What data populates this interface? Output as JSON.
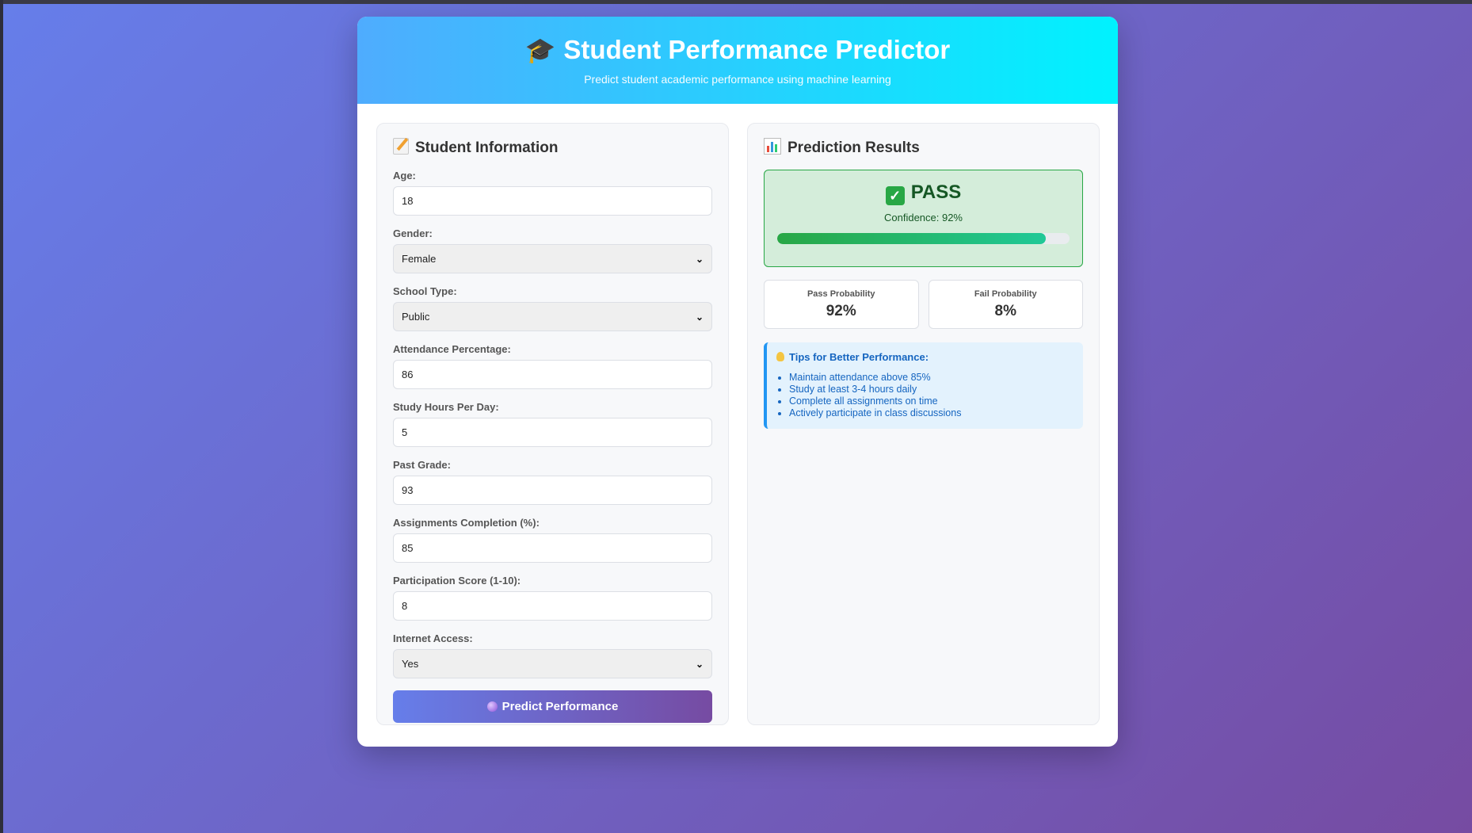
{
  "header": {
    "title": "Student Performance Predictor",
    "subtitle": "Predict student academic performance using machine learning"
  },
  "form": {
    "heading": "Student Information",
    "fields": {
      "age": {
        "label": "Age:",
        "value": "18"
      },
      "gender": {
        "label": "Gender:",
        "value": "Female"
      },
      "school_type": {
        "label": "School Type:",
        "value": "Public"
      },
      "attendance": {
        "label": "Attendance Percentage:",
        "value": "86"
      },
      "study_hours": {
        "label": "Study Hours Per Day:",
        "value": "5"
      },
      "past_grade": {
        "label": "Past Grade:",
        "value": "93"
      },
      "assignments": {
        "label": "Assignments Completion (%):",
        "value": "85"
      },
      "participation": {
        "label": "Participation Score (1-10):",
        "value": "8"
      },
      "internet": {
        "label": "Internet Access:",
        "value": "Yes"
      }
    },
    "predict_label": "Predict Performance"
  },
  "results": {
    "heading": "Prediction Results",
    "status": "PASS",
    "confidence_text": "Confidence: 92%",
    "confidence_level": 0.92,
    "pass_label": "Pass Probability",
    "pass_value": "92%",
    "fail_label": "Fail Probability",
    "fail_value": "8%"
  },
  "tips": {
    "title": "Tips for Better Performance:",
    "items": [
      "Maintain attendance above 85%",
      "Study at least 3-4 hours daily",
      "Complete all assignments on time",
      "Actively participate in class discussions"
    ]
  },
  "colors": {
    "background_start": "#667eea",
    "background_end": "#764ba2",
    "header_start": "#4facfe",
    "header_end": "#00f2fe",
    "pass_green": "#28a745"
  },
  "icons": {
    "title": "graduation-cap-icon",
    "form": "memo-icon",
    "results": "bar-chart-icon",
    "status": "check-mark-icon",
    "tips": "light-bulb-icon",
    "predict": "crystal-ball-icon"
  }
}
